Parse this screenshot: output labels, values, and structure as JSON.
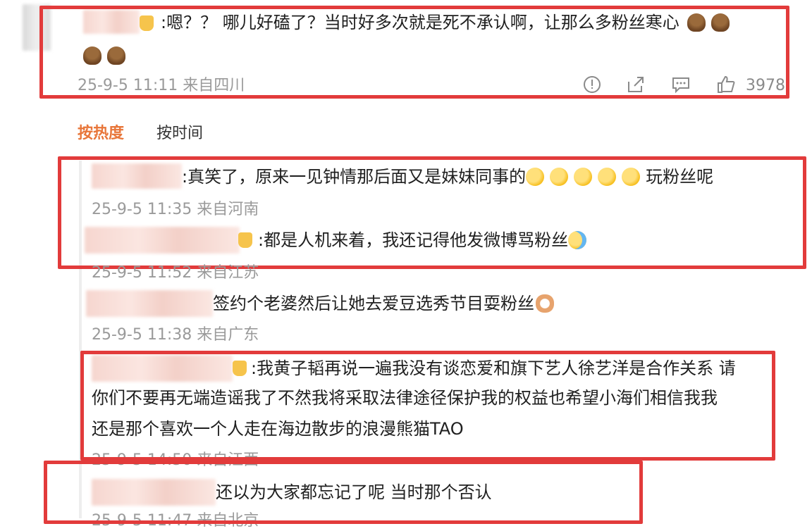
{
  "top_comment": {
    "text": ":嗯？？ 哪儿好磕了？当时好多次就是死不承认啊，让那么多粉丝寒心",
    "meta": "25-9-5 11:11 来自四川",
    "like_count": "3978",
    "icons": [
      "report-icon",
      "share-icon",
      "comment-icon",
      "like-icon"
    ],
    "emojis": [
      "poop-emoji",
      "poop-emoji",
      "poop-emoji",
      "poop-emoji"
    ]
  },
  "sort_tabs": [
    {
      "label": "按热度",
      "active": true,
      "color": "#e8763a"
    },
    {
      "label": "按时间",
      "active": false,
      "color": "#333333"
    }
  ],
  "replies": [
    {
      "text": ":真笑了，原来一见钟情那后面又是妹妹同事的",
      "tail": "玩粉丝呢",
      "meta": "25-9-5 11:35 来自河南"
    },
    {
      "text": ":都是人机来着，我还记得他发微博骂粉丝",
      "meta": "25-9-5 11:52 来自江苏"
    },
    {
      "text": "签约个老婆然后让她去爱豆选秀节目耍粉丝",
      "meta": "25-9-5 11:38 来自广东"
    },
    {
      "lines": [
        ":我黄子韬再说一遍我没有谈恋爱和旗下艺人徐艺洋是合作关系 请",
        "你们不要再无端造谣我了不然我将采取法律途径保护我的权益也希望小海们相信我我",
        "还是那个喜欢一个人走在海边散步的浪漫熊猫TAO"
      ],
      "meta": "25-9-5 14:50 来自江西"
    },
    {
      "text": "还以为大家都忘记了呢 当时那个否认",
      "meta": "25-9-5 11:47 来自北京"
    }
  ],
  "colors": {
    "highlight_box": "#e23b3b",
    "meta_text": "#9a9a9a",
    "active_sort": "#e8763a"
  }
}
